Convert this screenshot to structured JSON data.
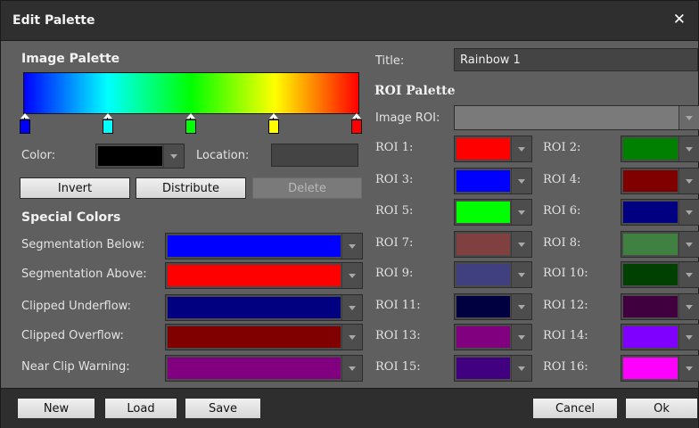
{
  "window": {
    "title": "Edit Palette"
  },
  "image_palette": {
    "header": "Image Palette",
    "gradient_colors": [
      "#0000ff",
      "#00ffff",
      "#00ff00",
      "#ffff00",
      "#ff0000"
    ],
    "markers": [
      {
        "color": "#0000ff"
      },
      {
        "color": "#00ffff"
      },
      {
        "color": "#00ff00"
      },
      {
        "color": "#ffff00"
      },
      {
        "color": "#ff0000"
      }
    ],
    "color_label": "Color:",
    "color_value": "#000000",
    "location_label": "Location:",
    "location_value": "",
    "buttons": {
      "invert": "Invert",
      "distribute": "Distribute",
      "delete": "Delete"
    }
  },
  "special_colors": {
    "header": "Special Colors",
    "items": [
      {
        "label": "Segmentation Below:",
        "color": "#0000ff"
      },
      {
        "label": "Segmentation Above:",
        "color": "#ff0000"
      },
      {
        "label": "Clipped Underflow:",
        "color": "#000080"
      },
      {
        "label": "Clipped Overflow:",
        "color": "#800000"
      },
      {
        "label": "Near Clip Warning:",
        "color": "#800080"
      }
    ]
  },
  "title_field": {
    "label": "Title:",
    "value": "Rainbow 1"
  },
  "roi_palette": {
    "header": "ROI Palette",
    "image_roi_label": "Image ROI:",
    "image_roi_value": "",
    "rois": [
      {
        "label": "ROI 1:",
        "color": "#ff0000"
      },
      {
        "label": "ROI 2:",
        "color": "#008000"
      },
      {
        "label": "ROI 3:",
        "color": "#0000ff"
      },
      {
        "label": "ROI 4:",
        "color": "#800000"
      },
      {
        "label": "ROI 5:",
        "color": "#00ff00"
      },
      {
        "label": "ROI 6:",
        "color": "#000080"
      },
      {
        "label": "ROI 7:",
        "color": "#804040"
      },
      {
        "label": "ROI 8:",
        "color": "#408040"
      },
      {
        "label": "ROI 9:",
        "color": "#404080"
      },
      {
        "label": "ROI 10:",
        "color": "#004000"
      },
      {
        "label": "ROI 11:",
        "color": "#000040"
      },
      {
        "label": "ROI 12:",
        "color": "#400040"
      },
      {
        "label": "ROI 13:",
        "color": "#800080"
      },
      {
        "label": "ROI 14:",
        "color": "#8000ff"
      },
      {
        "label": "ROI 15:",
        "color": "#400080"
      },
      {
        "label": "ROI 16:",
        "color": "#ff00ff"
      }
    ]
  },
  "footer": {
    "new": "New",
    "load": "Load",
    "save": "Save",
    "cancel": "Cancel",
    "ok": "Ok"
  }
}
